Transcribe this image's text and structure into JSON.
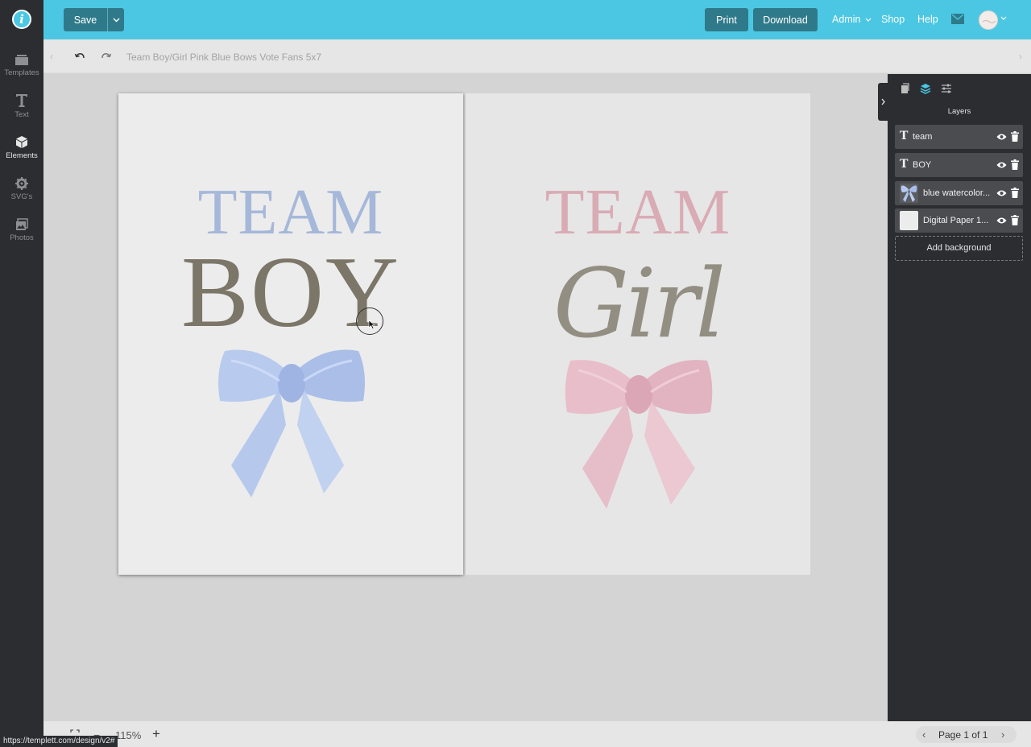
{
  "topbar": {
    "save_label": "Save",
    "print_label": "Print",
    "download_label": "Download",
    "admin_label": "Admin",
    "shop_label": "Shop",
    "help_label": "Help",
    "accent_color": "#4cc7e3"
  },
  "sidebar": {
    "items": [
      {
        "label": "Templates",
        "icon": "templates-icon"
      },
      {
        "label": "Text",
        "icon": "text-icon"
      },
      {
        "label": "Elements",
        "icon": "elements-icon"
      },
      {
        "label": "SVG's",
        "icon": "svg-icon"
      },
      {
        "label": "Photos",
        "icon": "photos-icon"
      }
    ],
    "active": "Elements"
  },
  "subbar": {
    "document_title": "Team Boy/Girl Pink Blue Bows Vote Fans 5x7"
  },
  "canvas": {
    "left_card": {
      "team": "TEAM",
      "word": "BOY",
      "team_color": "#a6b8d9",
      "word_color": "#7b7668",
      "bow_color": "#aec4ec"
    },
    "right_card": {
      "team": "TEAM",
      "word": "Girl",
      "team_color": "#d9abb5",
      "word_color": "#928e82",
      "bow_color": "#e4b5c3"
    }
  },
  "layers_panel": {
    "title": "Layers",
    "layers": [
      {
        "name": "team",
        "type": "text"
      },
      {
        "name": "BOY",
        "type": "text"
      },
      {
        "name": "blue watercolor...",
        "type": "image"
      },
      {
        "name": "Digital Paper 1...",
        "type": "image"
      }
    ],
    "add_background_label": "Add background"
  },
  "bottombar": {
    "zoom_minus": "−",
    "zoom_level": "115%",
    "zoom_plus": "+",
    "page_text": "Page 1 of 1"
  },
  "status_url": "https://templett.com/design/v2#"
}
